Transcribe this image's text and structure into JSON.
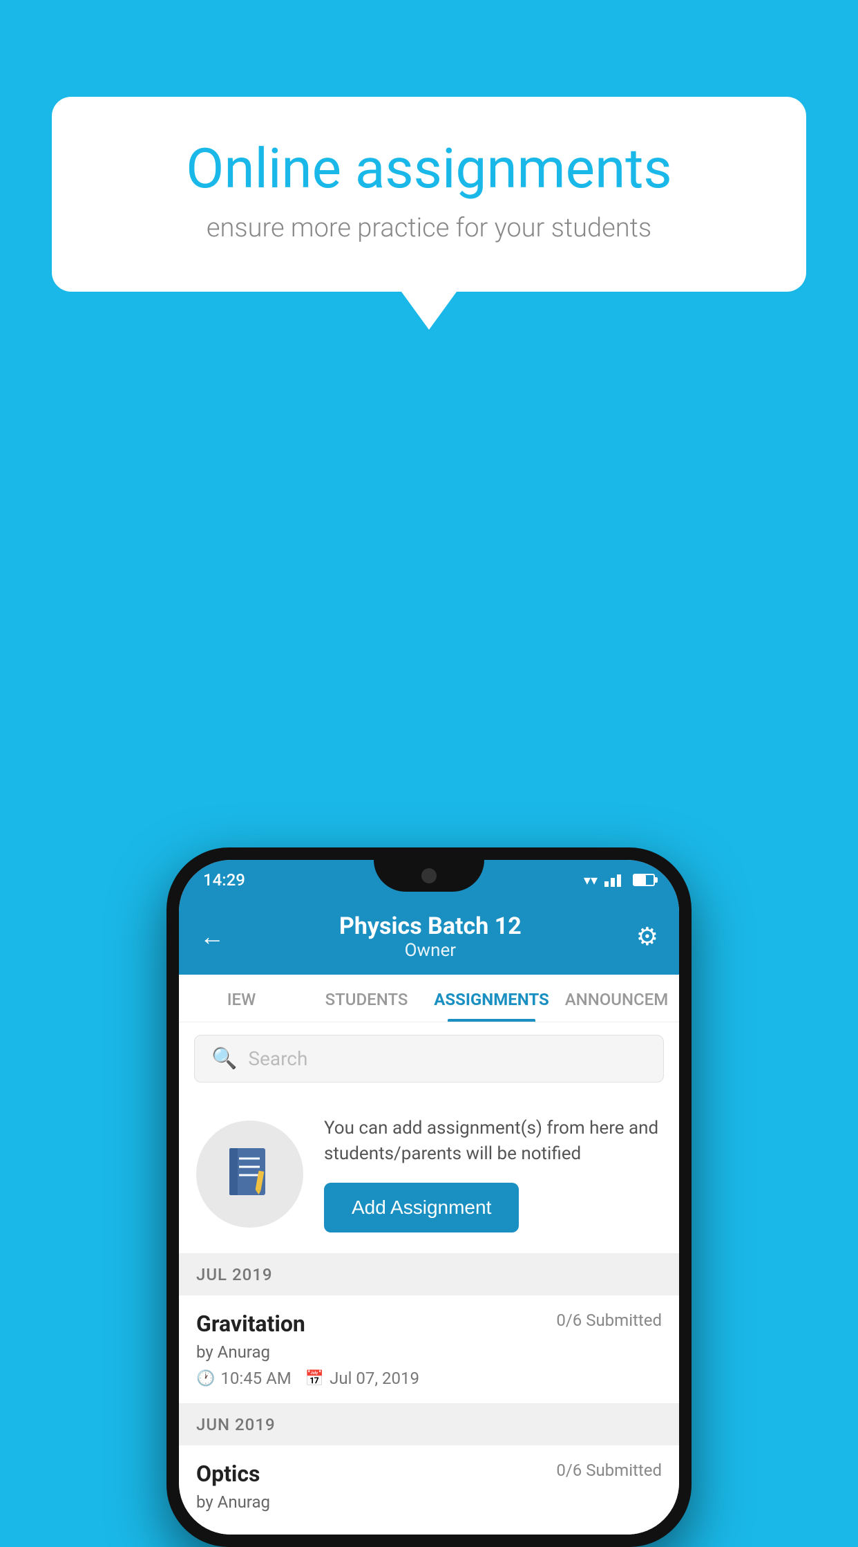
{
  "background_color": "#1ab8e8",
  "speech_bubble": {
    "title": "Online assignments",
    "subtitle": "ensure more practice for your students"
  },
  "phone": {
    "status_bar": {
      "time": "14:29"
    },
    "header": {
      "title": "Physics Batch 12",
      "subtitle": "Owner",
      "back_label": "←",
      "gear_label": "⚙"
    },
    "tabs": [
      {
        "label": "IEW",
        "active": false
      },
      {
        "label": "STUDENTS",
        "active": false
      },
      {
        "label": "ASSIGNMENTS",
        "active": true
      },
      {
        "label": "ANNOUNCEM",
        "active": false
      }
    ],
    "search": {
      "placeholder": "Search"
    },
    "add_assignment_section": {
      "description": "You can add assignment(s) from here and students/parents will be notified",
      "button_label": "Add Assignment"
    },
    "sections": [
      {
        "header": "JUL 2019",
        "assignments": [
          {
            "title": "Gravitation",
            "submitted": "0/6 Submitted",
            "author": "by Anurag",
            "time": "10:45 AM",
            "date": "Jul 07, 2019"
          }
        ]
      },
      {
        "header": "JUN 2019",
        "assignments": [
          {
            "title": "Optics",
            "submitted": "0/6 Submitted",
            "author": "by Anurag",
            "time": "",
            "date": ""
          }
        ]
      }
    ]
  }
}
